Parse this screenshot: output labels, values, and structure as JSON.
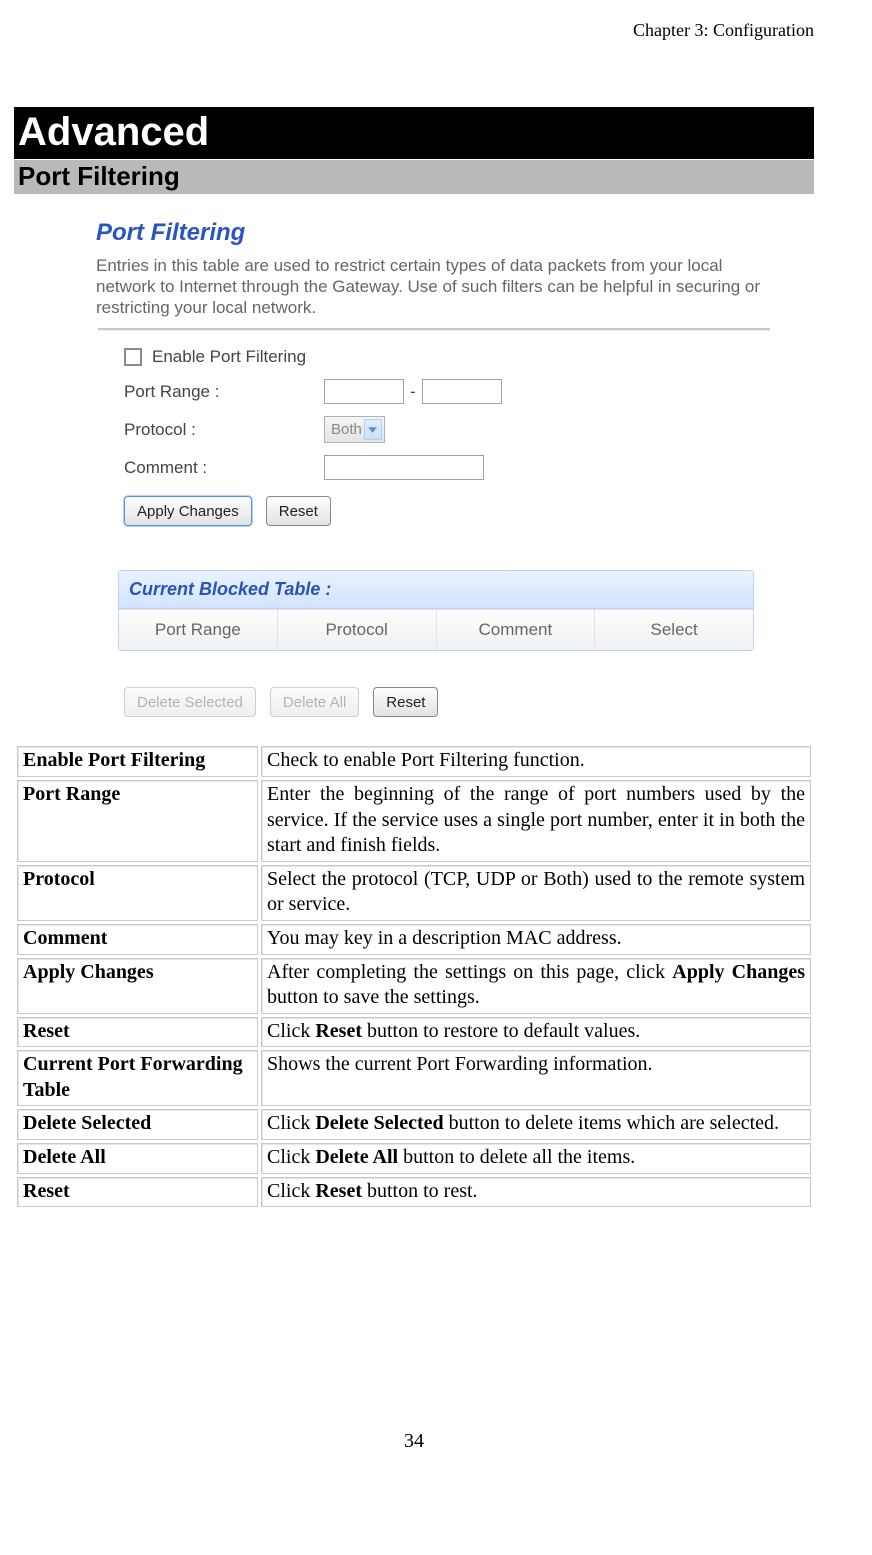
{
  "chapter": "Chapter 3: Configuration",
  "title_black": "Advanced",
  "title_gray": "Port Filtering",
  "page_number": "34",
  "shot": {
    "title": "Port Filtering",
    "desc": "Entries in this table are used to restrict certain types of data packets from your local network to Internet through the Gateway. Use of such filters can be helpful in securing or restricting your local network.",
    "enable_label": "Enable Port Filtering",
    "port_range_label": "Port Range :",
    "port_separator": "-",
    "protocol_label": "Protocol :",
    "protocol_value": "Both",
    "comment_label": "Comment :",
    "apply_btn": "Apply Changes",
    "reset_btn": "Reset",
    "cbt_title": "Current Blocked Table :",
    "cbt_cols": [
      "Port Range",
      "Protocol",
      "Comment",
      "Select"
    ],
    "del_sel_btn": "Delete Selected",
    "del_all_btn": "Delete All",
    "reset2_btn": "Reset"
  },
  "defs": [
    {
      "label": "Enable Port Filtering",
      "desc": "Check to enable Port Filtering function."
    },
    {
      "label": "Port Range",
      "desc": "Enter the beginning of the range of port numbers used by the service. If the service uses a single port number, enter it in both the start and finish fields."
    },
    {
      "label": "Protocol",
      "desc": "Select the protocol (TCP, UDP or Both) used to the remote system or service."
    },
    {
      "label": "Comment",
      "desc": "You may key in a description MAC address."
    },
    {
      "label": "Apply Changes",
      "desc_pre": "After completing the settings on this page, click ",
      "desc_bold": "Apply Changes",
      "desc_post": " button to save the settings."
    },
    {
      "label": "Reset",
      "desc_pre": "Click ",
      "desc_bold": "Reset",
      "desc_post": " button to restore to default values."
    },
    {
      "label": "Current Port Forwarding Table",
      "desc": "Shows the current Port Forwarding information."
    },
    {
      "label": "Delete Selected",
      "desc_pre": "Click ",
      "desc_bold": "Delete Selected",
      "desc_post": " button to delete items which are selected."
    },
    {
      "label": "Delete All",
      "desc_pre": "Click ",
      "desc_bold": "Delete All",
      "desc_post": " button to delete all the items."
    },
    {
      "label": "Reset",
      "desc_pre": "Click ",
      "desc_bold": "Reset",
      "desc_post": " button to rest."
    }
  ]
}
